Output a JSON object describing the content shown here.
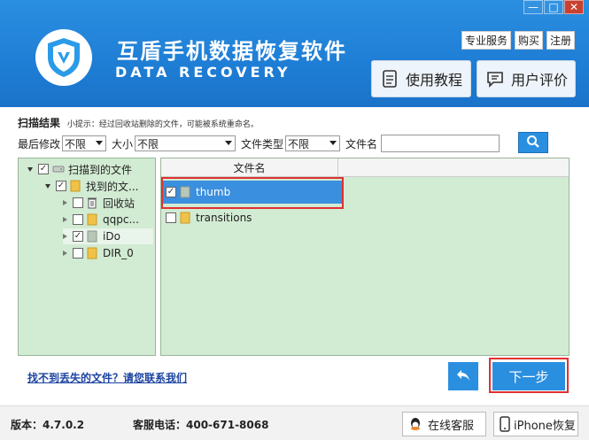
{
  "app": {
    "title": "互盾手机数据恢复软件",
    "subtitle": "DATA RECOVERY"
  },
  "window": {
    "minimize": "—",
    "maximize": "□",
    "close": "✕"
  },
  "top_links": [
    "专业服务",
    "购买",
    "注册"
  ],
  "header_buttons": {
    "tutorial": "使用教程",
    "review": "用户评价"
  },
  "scan": {
    "title": "扫描结果",
    "hint": "小提示：经过回收站删除的文件，可能被系统重命名。"
  },
  "filters": {
    "modified_label": "最后修改",
    "modified_value": "不限",
    "size_label": "大小",
    "size_value": "不限",
    "type_label": "文件类型",
    "type_value": "不限",
    "name_label": "文件名",
    "name_value": ""
  },
  "tree": {
    "root": "扫描到的文件",
    "found": "找到的文...",
    "items": [
      "回收站",
      "qqpc...",
      "iDo",
      "DIR_0"
    ]
  },
  "list": {
    "column_header": "文件名",
    "rows": [
      {
        "name": "thumb",
        "checked": true
      },
      {
        "name": "transitions",
        "checked": false
      }
    ]
  },
  "actions": {
    "help_link": "找不到丢失的文件？请您联系我们",
    "next": "下一步"
  },
  "footer": {
    "version": "版本：4.7.0.2",
    "phone": "客服电话：400-671-8068",
    "online_service": "在线客服",
    "iphone_recovery": "iPhone恢复"
  },
  "colors": {
    "header_blue": "#1f7fd6",
    "panel_green": "#d2ebd3",
    "selection_blue": "#3a8fde",
    "highlight_red": "#e03030",
    "button_blue": "#2b8fe0"
  }
}
